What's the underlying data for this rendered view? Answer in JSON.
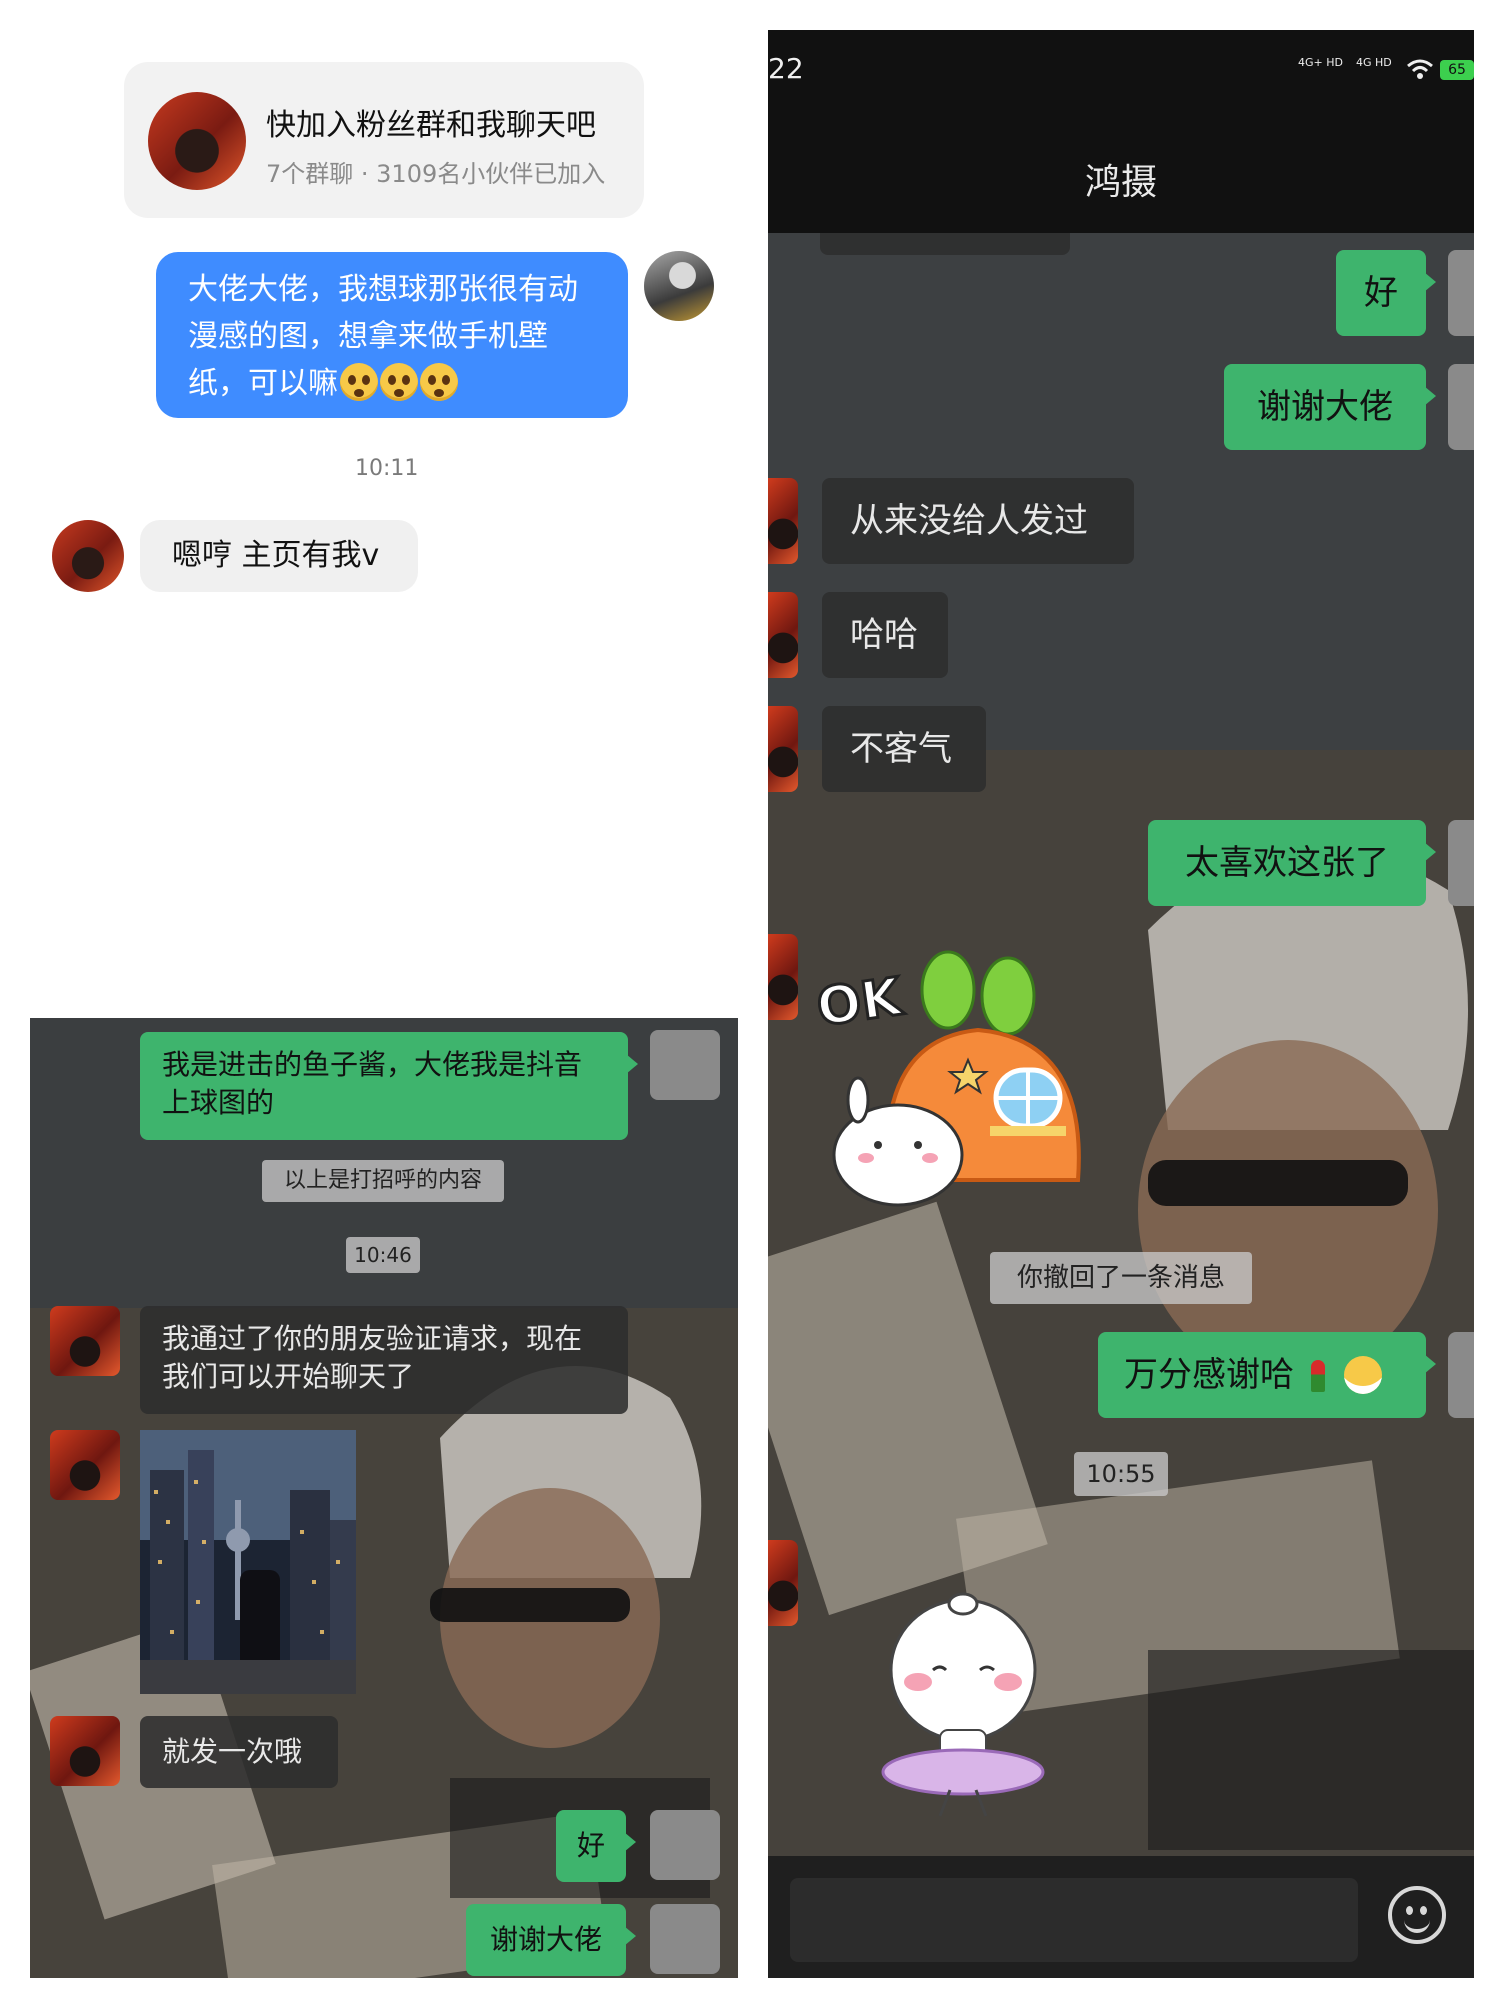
{
  "top_left": {
    "group_card": {
      "title": "快加入粉丝群和我聊天吧",
      "subtitle": "7个群聊 · 3109名小伙伴已加入"
    },
    "my_message": {
      "line1": "大佬大佬，我想球那张很有动",
      "line2": "漫感的图，想拿来做手机壁",
      "line3": "纸，可以嘛"
    },
    "time": "10:11",
    "reply": "嗯哼 主页有我v"
  },
  "bottom_left": {
    "msg_intro_line1": "我是进击的鱼子酱，大佬我是抖音",
    "msg_intro_line2": "上球图的",
    "system_note": "以上是打招呼的内容",
    "time": "10:46",
    "friend_line1": "我通过了你的朋友验证请求，现在",
    "friend_line2": "我们可以开始聊天了",
    "once": "就发一次哦",
    "ok": "好",
    "thanks": "谢谢大佬"
  },
  "right": {
    "status_time": "22",
    "status_net1": "4G+ HD",
    "status_net2": "4G HD",
    "battery": "65",
    "title": "鸿摄",
    "ok": "好",
    "thanks": "谢谢大佬",
    "never": "从来没给人发过",
    "haha": "哈哈",
    "welcome": "不客气",
    "love": "太喜欢这张了",
    "sticker_ok_text": "OK",
    "recalled": "你撤回了一条消息",
    "grateful": "万分感谢哈",
    "time": "10:55"
  }
}
